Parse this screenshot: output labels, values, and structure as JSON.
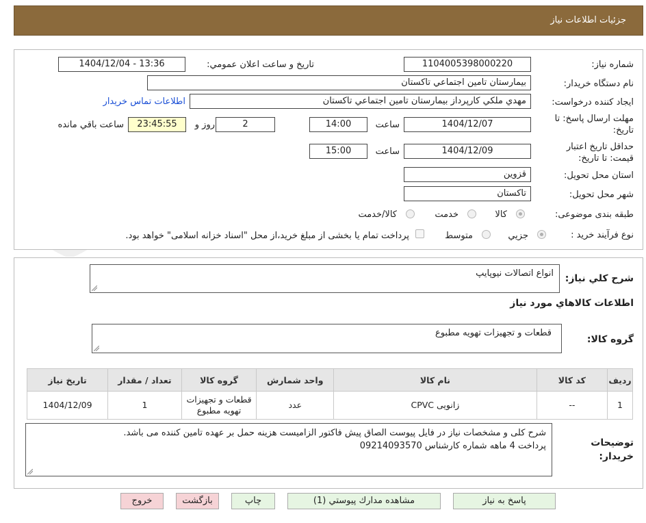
{
  "header": {
    "title": "جزئيات اطلاعات نياز"
  },
  "details": {
    "need_number_label": "شماره نياز:",
    "need_number": "1104005398000220",
    "announce_label": "تاريخ و ساعت اعلان عمومي:",
    "announce_value": "1404/12/04 - 13:36",
    "buyer_org_label": "نام دستگاه خريدار:",
    "buyer_org": "بيمارستان تامين اجتماعي تاکستان",
    "requester_label": "ايجاد کننده درخواست:",
    "requester": "مهدي ملکي کارپرداز بيمارستان تامين اجتماعي تاکستان",
    "contact_link": "اطلاعات تماس خريدار",
    "deadline_label": "مهلت ارسال پاسخ: تا تاريخ:",
    "deadline_date": "1404/12/07",
    "time_label": "ساعت",
    "deadline_time": "14:00",
    "days_value": "2",
    "days_label": "روز و",
    "remaining_value": "23:45:55",
    "remaining_label": "ساعت باقي مانده",
    "validity_label": "حداقل تاريخ اعتبار قيمت: تا تاريخ:",
    "validity_date": "1404/12/09",
    "validity_time": "15:00",
    "province_label": "استان محل تحويل:",
    "province": "قزوين",
    "city_label": "شهر محل تحويل:",
    "city": "تاکستان",
    "category_label": "طبقه بندی موضوعی:",
    "category_options": [
      "کالا",
      "خدمت",
      "کالا/خدمت"
    ],
    "process_label": "نوع فرآيند خريد :",
    "process_options": [
      "جزيي",
      "متوسط"
    ],
    "process_note": "پرداخت تمام يا بخشی از مبلغ خريد،از محل \"اسناد خزانه اسلامی\" خواهد بود."
  },
  "summary": {
    "label": "شرح كلي نياز:",
    "value": "انواع اتصالات نيوپايپ",
    "goods_title": "اطلاعات کالاهاي مورد نياز",
    "group_label": "گروه کالا:",
    "group_value": "قطعات و تجهيزات تهويه مطبوع"
  },
  "table": {
    "headers": [
      "رديف",
      "کد کالا",
      "نام کالا",
      "واحد شمارش",
      "گروه کالا",
      "تعداد / مقدار",
      "تاريخ نياز"
    ],
    "rows": [
      [
        "1",
        "--",
        "زانويی CPVC",
        "عدد",
        "قطعات و تجهيزات تهويه مطبوع",
        "1",
        "1404/12/09"
      ]
    ]
  },
  "buyer_notes": {
    "label": "توضيحات خريدار:",
    "line1": "شرح کلی و مشخصات نياز در فايل پيوست  الصاق پيش فاکتور  الزاميست هزينه حمل بر عهده تامين کننده می باشد.",
    "line2": "پرداخت 4 ماهه  شماره کارشناس 09214093570"
  },
  "buttons": {
    "reply": "پاسخ به نياز",
    "attachments": "مشاهده مدارك پيوستي (1)",
    "print": "چاپ",
    "back": "بازگشت",
    "exit": "خروج"
  },
  "watermark": {
    "text": "AriaTender.neT"
  },
  "colors": {
    "header_bg": "#8b6a3c",
    "link": "#1a4fd6",
    "remaining_bg": "#ffffcc",
    "green_btn": "#e6f5e2",
    "pink_btn": "#f6d3d6"
  }
}
